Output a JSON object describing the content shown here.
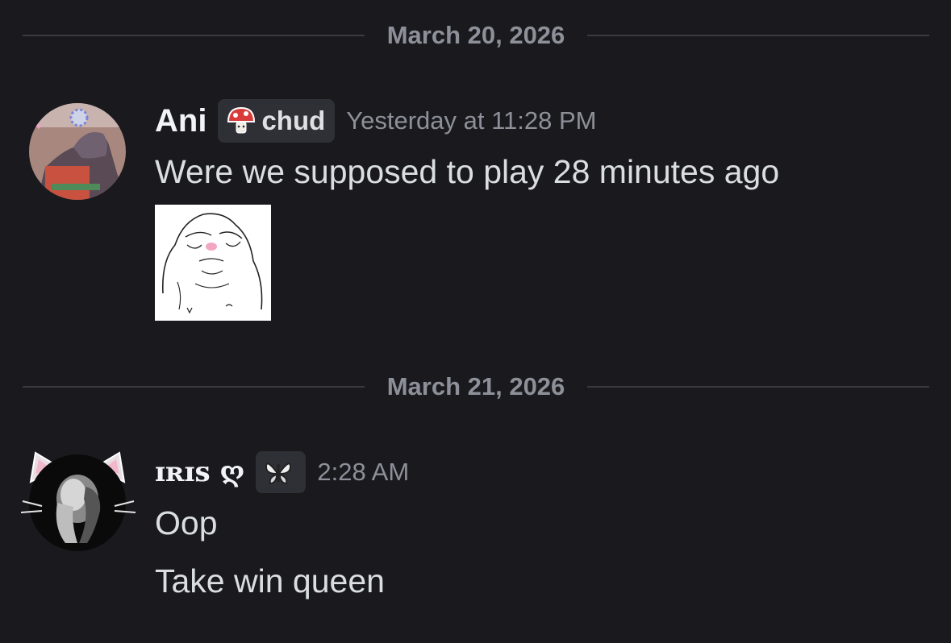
{
  "dividers": [
    {
      "date": "March 20, 2026"
    },
    {
      "date": "March 21, 2026"
    }
  ],
  "messages": [
    {
      "author": "Ani",
      "tag": {
        "icon": "mushroom-icon",
        "label": "chud"
      },
      "timestamp": "Yesterday at 11:28 PM",
      "lines": [
        "Were we supposed to play 28 minutes ago"
      ],
      "attachment": {
        "kind": "image",
        "subject": "sketch-face"
      }
    },
    {
      "author": "ɪʀɪꜱ ღ",
      "tag": {
        "icon": "butterfly-icon",
        "label": ""
      },
      "timestamp": "2:28 AM",
      "lines": [
        "Oop",
        "Take win queen"
      ]
    }
  ],
  "colors": {
    "background": "#1a1a1e",
    "divider_line": "#3a3b41",
    "muted_text": "#8e9099",
    "message_text": "#dbdee1",
    "author_text": "#f2f3f5",
    "tag_background": "#2f3036"
  }
}
